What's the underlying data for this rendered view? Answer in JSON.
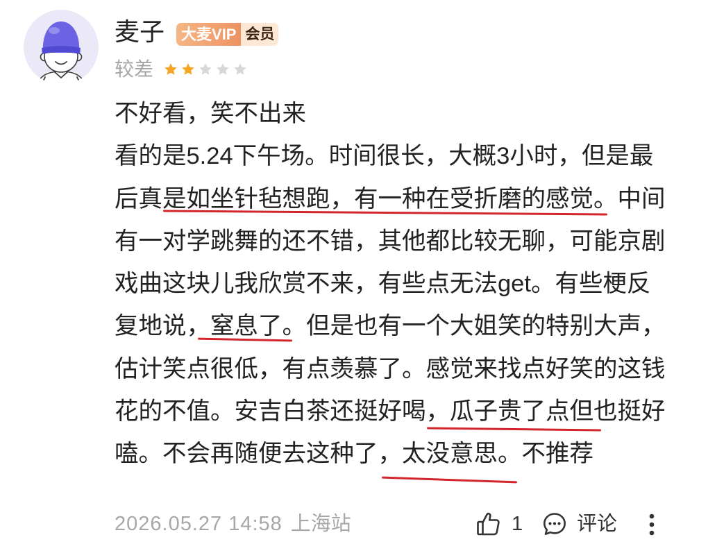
{
  "user": {
    "name": "麦子",
    "avatar_icon": "user-avatar-icon",
    "badge": {
      "brand": "大麦VIP",
      "label": "会员"
    }
  },
  "rating": {
    "label": "较差",
    "stars_filled": 2,
    "stars_total": 5
  },
  "review": {
    "lines": [
      {
        "segments": [
          {
            "text": "不好看，笑不出来"
          }
        ]
      },
      {
        "segments": [
          {
            "text": "看的是5.24下午场。时间很长，大概3小时，但是最"
          }
        ]
      },
      {
        "segments": [
          {
            "text": "后真"
          },
          {
            "text": "是如坐针毡想跑，有一种在受折磨的感觉",
            "underlined": true
          },
          {
            "text": "。中间"
          }
        ]
      },
      {
        "segments": [
          {
            "text": "有一对学跳舞的还不错，其他都比较无聊，可能京剧"
          }
        ]
      },
      {
        "segments": [
          {
            "text": "戏曲这块儿我欣赏不来，有些点无法get。有些梗反"
          }
        ]
      },
      {
        "segments": [
          {
            "text": "复地说，"
          },
          {
            "text": "窒息了",
            "underlined": true
          },
          {
            "text": "。但是也有一个大姐笑的特别大声，"
          }
        ]
      },
      {
        "segments": [
          {
            "text": "估计笑点很低，有点羡慕了。感觉来找点好笑的这钱"
          }
        ]
      },
      {
        "segments": [
          {
            "text": "花的不值。安吉白茶还挺好喝，"
          },
          {
            "text": "瓜子贵了点但也",
            "underlined": true
          },
          {
            "text": "挺好"
          }
        ]
      },
      {
        "segments": [
          {
            "text": "嗑。不会再随便去这种了，"
          },
          {
            "text": "太没意思",
            "underlined": true
          },
          {
            "text": "。不推荐"
          }
        ]
      }
    ]
  },
  "footer": {
    "timestamp": "2026.05.27 14:58",
    "location": "上海站",
    "like_count": "1",
    "comment_label": "评论",
    "like_icon": "thumbs-up-icon",
    "comment_icon": "comment-icon",
    "more_icon": "more-vertical-icon"
  },
  "colors": {
    "text": "#222222",
    "muted": "#a7a7a7",
    "icon": "#333333",
    "star_filled": "#f6a623",
    "star_empty": "#d8d8d8",
    "annotation": "#d3262b",
    "badge_brand_start": "#f5b685",
    "badge_brand_end": "#ee9262",
    "badge_brand_text": "#ffffff",
    "badge_label_bg": "#fde8d6",
    "badge_label_text": "#3e2413",
    "avatar_bg": "#ebe8f8",
    "avatar_cap": "#6b62e4",
    "avatar_cap_band": "#5249d2"
  }
}
